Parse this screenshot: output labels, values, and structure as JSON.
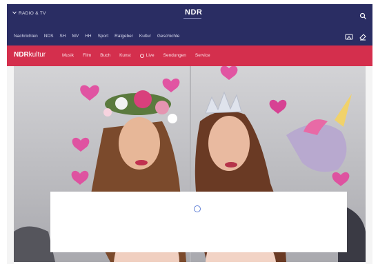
{
  "topbar": {
    "radio_label": "RADIO & TV",
    "logo": "NDR",
    "search_icon": "search-icon"
  },
  "main_nav": {
    "items": [
      "Nachrichten",
      "NDS",
      "SH",
      "MV",
      "HH",
      "Sport",
      "Ratgeber",
      "Kultur",
      "Geschichte"
    ],
    "icons": [
      "cast-icon",
      "eraser-icon"
    ]
  },
  "section_nav": {
    "brand_prefix": "NDR",
    "brand_suffix": "kultur",
    "items": [
      "Musik",
      "Film",
      "Buch",
      "Kunst",
      "Live",
      "Sendungen",
      "Service"
    ]
  },
  "hero": {
    "image": "photo-two-women-with-flower-crown-and-tiara",
    "decorations": "pink-heart-icons"
  },
  "colors": {
    "top_navy": "#2a2d63",
    "section_red": "#d42f4d",
    "spinner_blue": "#5f7fd6"
  }
}
